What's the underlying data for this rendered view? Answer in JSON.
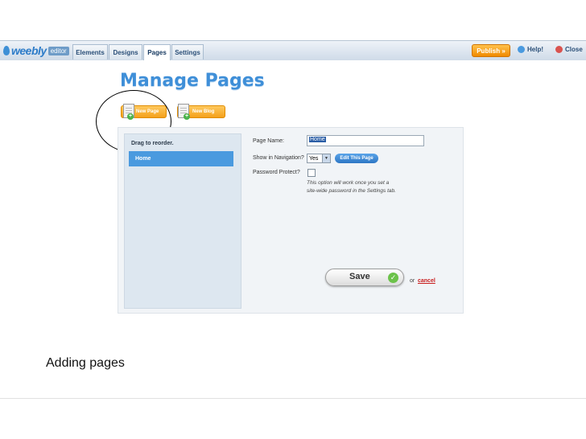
{
  "topbar": {
    "logo": "weebly",
    "logo_sub": "editor",
    "tabs": [
      "Elements",
      "Designs",
      "Pages",
      "Settings"
    ],
    "active_tab": "Pages",
    "publish_label": "Publish »",
    "help_label": "Help!",
    "close_label": "Close"
  },
  "page_title": "Manage Pages",
  "buttons": {
    "new_page": "New Page",
    "new_blog": "New Blog"
  },
  "sidebar": {
    "drag_label": "Drag to reorder.",
    "items": [
      {
        "label": "Home"
      }
    ]
  },
  "form": {
    "page_name_label": "Page Name:",
    "page_name_value": "Home",
    "show_nav_label": "Show in Navigation?",
    "show_nav_value": "Yes",
    "edit_button": "Edit This Page",
    "password_label": "Password Protect?",
    "password_checked": false,
    "note_line1": "This option will work once you set a",
    "note_line2": "site-wide password in the Settings tab."
  },
  "actions": {
    "save_label": "Save",
    "or_text": "or",
    "cancel_label": "cancel"
  },
  "caption": "Adding pages",
  "colors": {
    "accent_blue": "#3f8fd8",
    "orange": "#f4a11b",
    "selected_blue": "#4a9adf",
    "cancel_red": "#c81e1e"
  }
}
